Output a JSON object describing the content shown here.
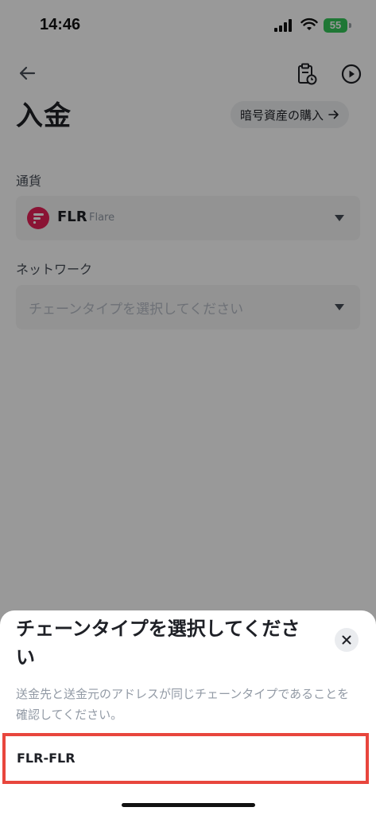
{
  "status_bar": {
    "time": "14:46",
    "battery": "55"
  },
  "header": {
    "title": "入金",
    "buy_button_label": "暗号資産の購入"
  },
  "form": {
    "currency_label": "通貨",
    "currency_symbol": "FLR",
    "currency_name": "Flare",
    "network_label": "ネットワーク",
    "network_placeholder": "チェーンタイプを選択してください"
  },
  "sheet": {
    "title": "チェーンタイプを選択してください",
    "description": "送金先と送金元のアドレスが同じチェーンタイプであることを確認してください。",
    "options": [
      {
        "label": "FLR-FLR"
      }
    ]
  },
  "colors": {
    "flare_brand": "#e62058",
    "highlight_border": "#e8463d",
    "battery_green": "#34c759"
  }
}
